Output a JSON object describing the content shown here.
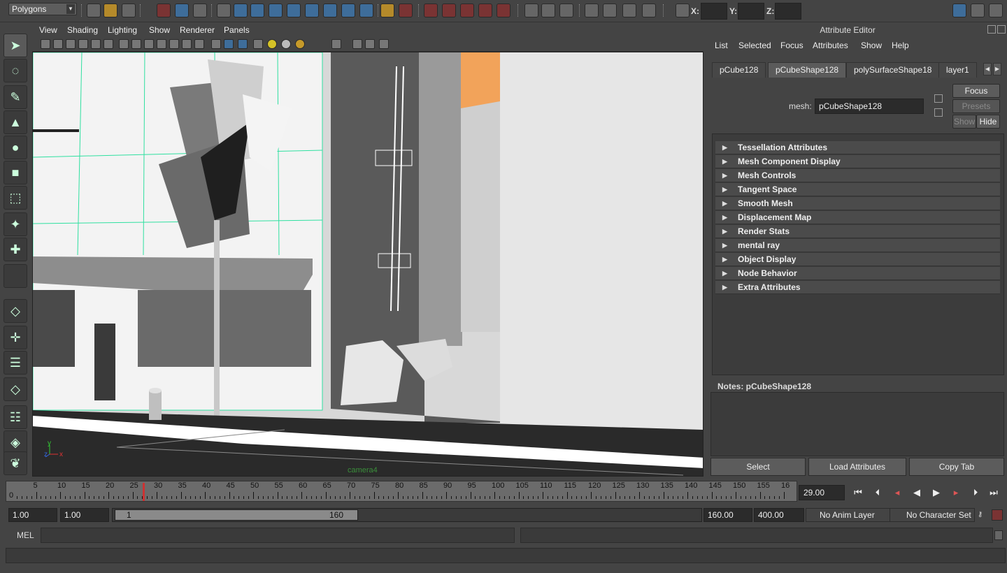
{
  "status_line": {
    "menu_set": "Polygons",
    "xyz_labels": [
      "X:",
      "Y:",
      "Z:"
    ]
  },
  "view_menu": [
    "View",
    "Shading",
    "Lighting",
    "Show",
    "Renderer",
    "Panels"
  ],
  "viewport": {
    "camera_label": "camera4",
    "axis_labels": [
      "y",
      "z",
      "x"
    ]
  },
  "attribute_editor": {
    "title": "Attribute Editor",
    "menu": [
      "List",
      "Selected",
      "Focus",
      "Attributes",
      "Show",
      "Help"
    ],
    "tabs": [
      "pCube128",
      "pCubeShape128",
      "polySurfaceShape18",
      "layer1"
    ],
    "active_tab": "pCubeShape128",
    "mesh_label": "mesh:",
    "mesh_value": "pCubeShape128",
    "focus_button": "Focus",
    "presets_button": "Presets",
    "show_button": "Show",
    "hide_button": "Hide",
    "sections": [
      "Tessellation Attributes",
      "Mesh Component Display",
      "Mesh Controls",
      "Tangent Space",
      "Smooth Mesh",
      "Displacement Map",
      "Render Stats",
      "mental ray",
      "Object Display",
      "Node Behavior",
      "Extra Attributes"
    ],
    "notes_label": "Notes:  pCubeShape128",
    "select_button": "Select",
    "load_attributes_button": "Load Attributes",
    "copy_tab_button": "Copy Tab"
  },
  "timeline": {
    "start_label": "0",
    "labels": [
      "5",
      "10",
      "15",
      "20",
      "25",
      "30",
      "35",
      "40",
      "45",
      "50",
      "55",
      "60",
      "65",
      "70",
      "75",
      "80",
      "85",
      "90",
      "95",
      "100",
      "105",
      "110",
      "115",
      "120",
      "125",
      "130",
      "135",
      "140",
      "145",
      "150",
      "155",
      "16"
    ],
    "current_frame": "29.00"
  },
  "range_slider": {
    "start_time": "1.00",
    "playback_start": "1.00",
    "handle_start": "1",
    "handle_end": "160",
    "playback_end": "160.00",
    "end_time": "400.00",
    "anim_layer": "No Anim Layer",
    "character_set": "No Character Set"
  },
  "command_line": {
    "label": "MEL"
  }
}
